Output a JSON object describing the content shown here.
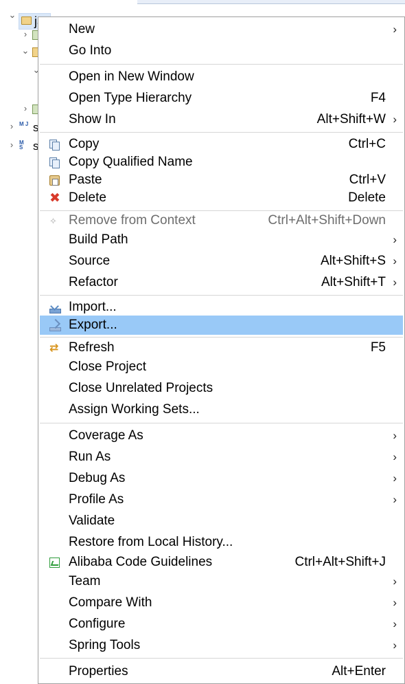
{
  "tree": {
    "root_label": "jar",
    "rows": [
      {
        "chevron": "expanded",
        "icon": "folder-icon",
        "label": "jar"
      },
      {
        "chevron": "collapsed",
        "icon": "library-icon",
        "label": ""
      },
      {
        "chevron": "expanded",
        "icon": "package-folder-icon",
        "label": ""
      },
      {
        "chevron": "expanded",
        "icon": "none",
        "label": ""
      },
      {
        "chevron": "collapsed",
        "icon": "library-icon",
        "label": ""
      },
      {
        "chevron": "collapsed",
        "icon": "maven-project-icon",
        "label": "s"
      },
      {
        "chevron": "collapsed",
        "icon": "maven-project-icon",
        "label": "s"
      }
    ]
  },
  "menu": {
    "new": {
      "label": "New",
      "submenu": true
    },
    "go_into": {
      "label": "Go Into"
    },
    "open_new_window": {
      "label": "Open in New Window"
    },
    "open_type_hierarchy": {
      "label": "Open Type Hierarchy",
      "shortcut": "F4"
    },
    "show_in": {
      "label": "Show In",
      "shortcut": "Alt+Shift+W",
      "submenu": true
    },
    "copy": {
      "label": "Copy",
      "shortcut": "Ctrl+C",
      "icon": "copy-icon"
    },
    "copy_qualified": {
      "label": "Copy Qualified Name",
      "icon": "copy-qualified-icon"
    },
    "paste": {
      "label": "Paste",
      "shortcut": "Ctrl+V",
      "icon": "paste-icon"
    },
    "delete": {
      "label": "Delete",
      "shortcut": "Delete",
      "icon": "delete-icon"
    },
    "remove_context": {
      "label": "Remove from Context",
      "shortcut": "Ctrl+Alt+Shift+Down",
      "disabled": true,
      "icon": "remove-context-icon"
    },
    "build_path": {
      "label": "Build Path",
      "submenu": true
    },
    "source": {
      "label": "Source",
      "shortcut": "Alt+Shift+S",
      "submenu": true
    },
    "refactor": {
      "label": "Refactor",
      "shortcut": "Alt+Shift+T",
      "submenu": true
    },
    "import": {
      "label": "Import...",
      "icon": "import-icon"
    },
    "export": {
      "label": "Export...",
      "icon": "export-icon",
      "selected": true
    },
    "refresh": {
      "label": "Refresh",
      "shortcut": "F5",
      "icon": "refresh-icon"
    },
    "close_project": {
      "label": "Close Project"
    },
    "close_unrelated": {
      "label": "Close Unrelated Projects"
    },
    "assign_working_sets": {
      "label": "Assign Working Sets..."
    },
    "coverage_as": {
      "label": "Coverage As",
      "submenu": true
    },
    "run_as": {
      "label": "Run As",
      "submenu": true
    },
    "debug_as": {
      "label": "Debug As",
      "submenu": true
    },
    "profile_as": {
      "label": "Profile As",
      "submenu": true
    },
    "validate": {
      "label": "Validate"
    },
    "restore_history": {
      "label": "Restore from Local History..."
    },
    "alibaba": {
      "label": "Alibaba Code Guidelines",
      "shortcut": "Ctrl+Alt+Shift+J",
      "icon": "alibaba-icon"
    },
    "team": {
      "label": "Team",
      "submenu": true
    },
    "compare_with": {
      "label": "Compare With",
      "submenu": true
    },
    "configure": {
      "label": "Configure",
      "submenu": true
    },
    "spring_tools": {
      "label": "Spring Tools",
      "submenu": true
    },
    "properties": {
      "label": "Properties",
      "shortcut": "Alt+Enter"
    }
  },
  "glyphs": {
    "submenu_arrow": "›",
    "chevron_collapsed": "›",
    "chevron_expanded": "⌄",
    "delete_x": "✖",
    "refresh": "⇄",
    "remove": "✧"
  },
  "colors": {
    "selection": "#99c9f7",
    "disabled_text": "#6d6d6d",
    "separator": "#d6d6d6"
  }
}
